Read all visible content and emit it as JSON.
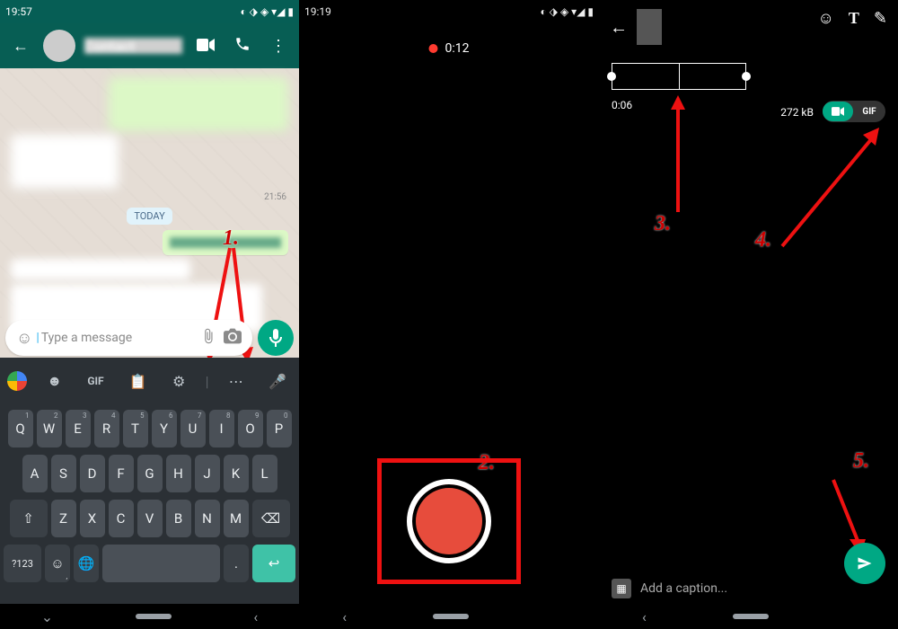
{
  "panel1": {
    "status_time": "19:57",
    "contact_name": "Contact",
    "timestamp1": "21:56",
    "day_label": "TODAY",
    "input_placeholder": "Type a message",
    "kbd_gif": "GIF",
    "kbd_sym": "?123",
    "keys_row1": [
      "Q",
      "W",
      "E",
      "R",
      "T",
      "Y",
      "U",
      "I",
      "O",
      "P"
    ],
    "keys_sup": [
      "1",
      "2",
      "3",
      "4",
      "5",
      "6",
      "7",
      "8",
      "9",
      "0"
    ],
    "keys_row2": [
      "A",
      "S",
      "D",
      "F",
      "G",
      "H",
      "J",
      "K",
      "L"
    ],
    "keys_row3": [
      "Z",
      "X",
      "C",
      "V",
      "B",
      "N",
      "M"
    ]
  },
  "panel2": {
    "status_time": "19:19",
    "rec_time": "0:12"
  },
  "panel3": {
    "trim_time": "0:06",
    "file_size": "272 kB",
    "toggle_gif_label": "GIF",
    "caption_placeholder": "Add a caption..."
  },
  "annotations": {
    "a1": "1.",
    "a2": "2.",
    "a3": "3.",
    "a4": "4.",
    "a5": "5."
  }
}
